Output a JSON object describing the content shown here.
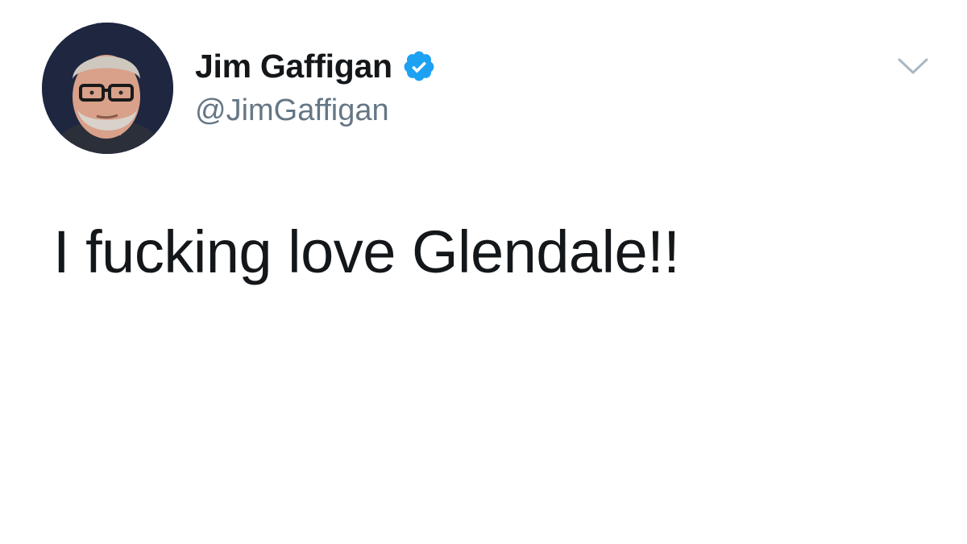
{
  "tweet": {
    "author": {
      "display_name": "Jim Gaffigan",
      "handle": "@JimGaffigan",
      "verified": true,
      "avatar_icon": "profile-photo"
    },
    "text": "I fucking love Glendale!!",
    "menu_icon": "chevron-down-icon"
  },
  "colors": {
    "text_primary": "#14171a",
    "text_secondary": "#657786",
    "verified_blue": "#1da1f2",
    "chevron_gray": "#aab8c2",
    "background": "#ffffff"
  }
}
